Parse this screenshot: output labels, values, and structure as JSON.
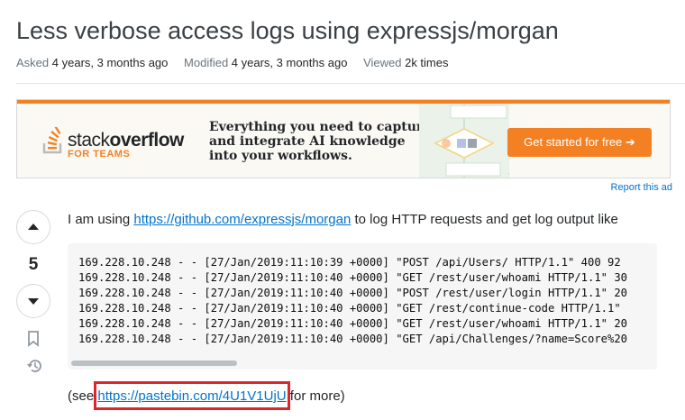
{
  "question": {
    "title": "Less verbose access logs using expressjs/morgan",
    "asked_label": "Asked",
    "asked_value": "4 years, 3 months ago",
    "modified_label": "Modified",
    "modified_value": "4 years, 3 months ago",
    "viewed_label": "Viewed",
    "viewed_value": "2k times"
  },
  "ad": {
    "logo_light": "stack",
    "logo_bold": "overflow",
    "logo_sub": "FOR TEAMS",
    "headline_1": "Everything you need to capture",
    "headline_2": "and integrate AI knowledge",
    "headline_3": "into your workflows.",
    "cta_label": "Get started for free",
    "cta_icon": "arrow-right-icon",
    "report_label": "Report this ad",
    "accent_color": "#f48024"
  },
  "votes": {
    "score": "5",
    "up_icon": "upvote-arrow-icon",
    "down_icon": "downvote-arrow-icon",
    "bookmark_icon": "bookmark-icon",
    "history_icon": "history-icon"
  },
  "post": {
    "intro_before": "I am using ",
    "intro_link": "https://github.com/expressjs/morgan",
    "intro_after": " to log HTTP requests and get log output like",
    "code_lines": [
      "169.228.10.248 - - [27/Jan/2019:11:10:39 +0000] \"POST /api/Users/ HTTP/1.1\" 400 92",
      "169.228.10.248 - - [27/Jan/2019:11:10:40 +0000] \"GET /rest/user/whoami HTTP/1.1\" 30",
      "169.228.10.248 - - [27/Jan/2019:11:10:40 +0000] \"POST /rest/user/login HTTP/1.1\" 20",
      "169.228.10.248 - - [27/Jan/2019:11:10:40 +0000] \"GET /rest/continue-code HTTP/1.1\"",
      "169.228.10.248 - - [27/Jan/2019:11:10:40 +0000] \"GET /rest/user/whoami HTTP/1.1\" 20",
      "169.228.10.248 - - [27/Jan/2019:11:10:40 +0000] \"GET /api/Challenges/?name=Score%20"
    ],
    "outro_before": "(see ",
    "outro_link": "https://pastebin.com/4U1V1UjU",
    "outro_after": " for more)"
  }
}
